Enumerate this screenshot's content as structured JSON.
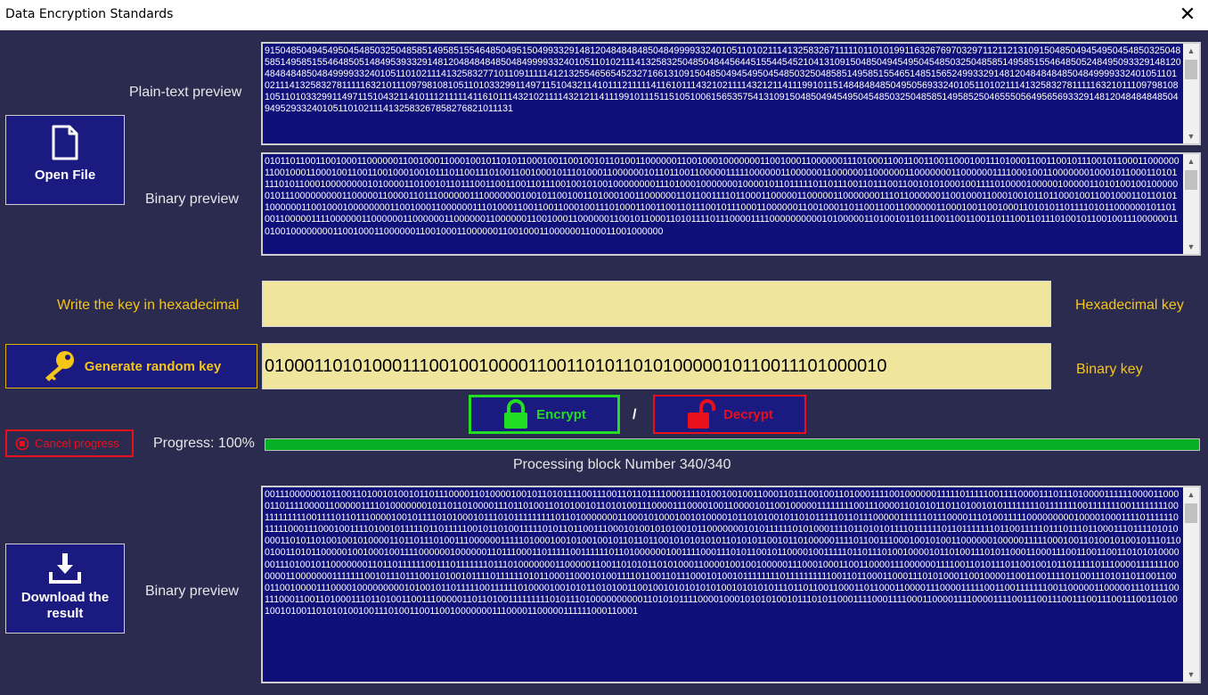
{
  "window": {
    "title": "Data Encryption Standards",
    "close_glyph": "✕"
  },
  "plaintext": {
    "label": "Plain-text preview",
    "content": "915048504945495045485032504858514958515546485049515049933291481204848484850484999933240105110102111413258326711111011010199116326769703297112112131091504850494549504548503250485851495851554648505148495393329148120484848485048499993324010511010211141325832504850484456445155445452104131091504850494549504548503250485851495851554648505248495093329148120484848485048499993324010511010211141325832771011091111141213255465654523271661310915048504945495045485032504858514958515546514851565249933291481204848484850484999933240105110102111413258327811111632101110979810810511010332991149711510432114101112111114116101114321021111432121141119910115148484848504950569332401051101021114132583278111116321011109798108105110103329911497115104321141011121111141161011143210211114321211411199101115115105100615653575413109150485049454950454850325048585149585250465550564956569332914812048484848504949529332401051101021114132583267858276821011131",
    "scroll_up": "▲",
    "scroll_down": "▼"
  },
  "binary_top": {
    "label": "Binary preview",
    "content": "010110110011001000110000001100100011000100101101011000100110010010110100110000001100100010000000110010001100000011101000110011001100110001001110100011001100101110010110001100000011001000110001001100110010001001011101100111010011001000101110100011000000101101100110000011111000000110000001100000011000000110000000110000001111000100110000000100010110001101011110101100010000000010100001101001011011100110011001101110010010100100000000111010001000000010000101101111101101110011011100110010101000100111101000010000010000011010100100100000010111000000000110000011000011011100000011100000001001011001001101000100110000001101100111101100011000001100000110000000111011000000110010001100010010110110001001100100011011010110000001100100010000000011001000110000001110100011001100110001001110100011001100110111001011100011000000110010001101100110011000000110001001100100011010101101111010110000001011010011000001111000000110000001100000011000000110000001100100011000000110010110001101011110111000011110000000000101000001101001011011100110011001101110011011101001011001001110000001101001000000001100100011000000110010001100000011001000110000001100011001000000",
    "scroll_up": "▲",
    "scroll_down": "▼"
  },
  "open_file": {
    "label": "Open File",
    "icon": "document-icon"
  },
  "key_hex": {
    "label": "Write the key in hexadecimal",
    "value": "",
    "side_label": "Hexadecimal key"
  },
  "generate_key": {
    "label": "Generate random key",
    "icon": "key-icon"
  },
  "key_bin": {
    "value": "0100011010100011100100100001100110101101010000010110011101000010",
    "side_label": "Binary key"
  },
  "actions": {
    "encrypt": "Encrypt",
    "separator": "/",
    "decrypt": "Decrypt",
    "encrypt_color": "#22dd22",
    "decrypt_color": "#e8101c"
  },
  "progress": {
    "cancel_label": "Cancel progress",
    "label": "Progress: 100%",
    "value": 1.0,
    "status": "Processing block Number 340/340"
  },
  "result": {
    "label": "Binary preview",
    "download_label": "Download the result",
    "content": "001110000001011001101001010010110111000011010000100101101011110011100110110111100011110100100100110001101110010011010001111001000000111110111110011110000111011101000011111100001100001101111000011000001111010000000101101101000011101101001101010010110101001110000111000010011000010110010000011111111001110000110101011011010010101111111101111111001111111001111111100111111111001111011011100001001011110101000101110101111111110110100000001100010100010010100001011010100101101011111011011100000111111011100001110100111110000000001000010001111011111101111100011100010011110100101111101101111100101101001111101011011001110001010010101001011000000010101111110101000111101101010111101111110110111111101100111110111011101100011101111010100001101011010010010100001101101110100111000000111110100010010100100101101101100101010101011010101100101101000001111011001110001001010011000000100000111110001001101001010010111011001001101011000001001000100111100000010000001101110001101111100111111011010000001001111000111010110010110000100111110110111010010000101101001110101100011000111001100110011010101000000111010010110000000110110111111001110111111101110100000001100000110011010101101010001100001001001000001110001000110011000011100000011110011010111011001001011011111011100001111111000000110000000111111100101110111001101001011110111111010110001100010100111101100110111000101001011111111011111111110011011000110001110101000110010000110011001111011001110101101100110001100100001110000100000000010100101101111100111111010000100101011010100110010010101010101001010101011101101100110001101100011000011100001111100110011111110011000001100000111011110011100011001101000111011010011001110000011011010011111111101011101000000000011010101111000010001010101001011101011000111100011110001100001111000011110011100111001110011100111001101001001010011010101001001110100110011001000000011100001100000111111000110001",
    "scroll_up": "▲",
    "scroll_down": "▼"
  }
}
